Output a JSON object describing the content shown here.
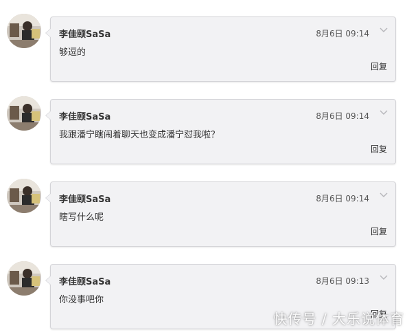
{
  "comments": [
    {
      "username": "李佳颐SaSa",
      "time": "8月6日 09:14",
      "content": "够逗的",
      "reply_label": "回复"
    },
    {
      "username": "李佳颐SaSa",
      "time": "8月6日 09:14",
      "content": "我跟潘宁瞎闹着聊天也变成潘宁怼我啦？",
      "reply_label": "回复"
    },
    {
      "username": "李佳颐SaSa",
      "time": "8月6日 09:14",
      "content": "瞎写什么呢",
      "reply_label": "回复"
    },
    {
      "username": "李佳颐SaSa",
      "time": "8月6日 09:13",
      "content": "你没事吧你",
      "reply_label": "回复"
    }
  ],
  "watermark": "快传号 / 大乐说体育",
  "icons": {
    "avatar": "user-avatar",
    "menu": "chevron-down-icon"
  },
  "colors": {
    "bubble_bg": "#f2f2f4",
    "bubble_border": "#d4d4d8",
    "text": "#333333"
  }
}
